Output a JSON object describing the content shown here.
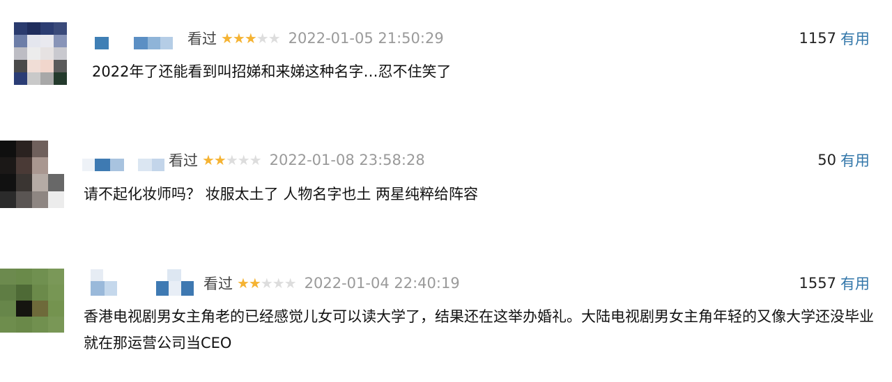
{
  "colors": {
    "star": "#f5b333",
    "star_empty": "#dddddd",
    "link": "#3377aa",
    "muted": "#9a9a9a"
  },
  "comments": [
    {
      "status": "看过",
      "rating": 3,
      "max_rating": 5,
      "time": "2022-01-05 21:50:29",
      "votes": "1157",
      "useful_label": "有用",
      "text": "2022年了还能看到叫招娣和来娣这种名字…忍不住笑了"
    },
    {
      "status": "看过",
      "rating": 2,
      "max_rating": 5,
      "time": "2022-01-08 23:58:28",
      "votes": "50",
      "useful_label": "有用",
      "text": "请不起化妆师吗？ 妆服太土了 人物名字也土 两星纯粹给阵容"
    },
    {
      "status": "看过",
      "rating": 2,
      "max_rating": 5,
      "time": "2022-01-04 22:40:19",
      "votes": "1557",
      "useful_label": "有用",
      "text": "香港电视剧男女主角老的已经感觉儿女可以读大学了，结果还在这举办婚礼。大陆电视剧男女主角年轻的又像大学还没毕业就在那运营公司当CEO"
    }
  ]
}
